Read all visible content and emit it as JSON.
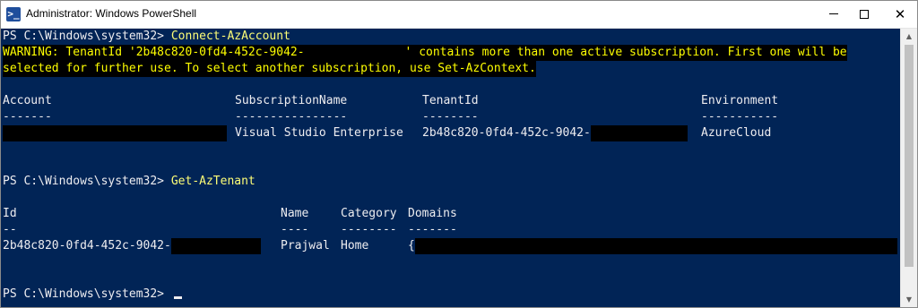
{
  "window": {
    "title": "Administrator: Windows PowerShell",
    "icon": "powershell-icon",
    "controls": {
      "minimize": "minimize-icon",
      "maximize": "maximize-icon",
      "close": "close-icon"
    }
  },
  "colors": {
    "console_background": "#012456",
    "console_text": "#eeedf0",
    "command_text": "#fefe77",
    "warning_text": "#fefe00",
    "warning_background": "#000000",
    "redaction": "#000000"
  },
  "console": {
    "prompt1": "PS C:\\Windows\\system32> ",
    "command1": "Connect-AzAccount",
    "warning_line1_part1": "WARNING: TenantId '2b48c820-0fd4-452c-9042-",
    "warning_line1_part2": "' contains more than one active subscription. First one will be",
    "warning_line2": "selected for further use. To select another subscription, use Set-AzContext.",
    "account_table": {
      "headers": [
        "Account",
        "SubscriptionName",
        "TenantId",
        "Environment"
      ],
      "underlines": [
        "-------",
        "----------------",
        "--------",
        "-----------"
      ],
      "row": {
        "subscription_name": "Visual Studio Enterprise",
        "tenant_id_prefix": "2b48c820-0fd4-452c-9042-",
        "environment": "AzureCloud"
      }
    },
    "prompt2": "PS C:\\Windows\\system32> ",
    "command2": "Get-AzTenant",
    "tenant_table": {
      "headers": [
        "Id",
        "Name",
        "Category",
        "Domains"
      ],
      "underlines": [
        "--",
        "----",
        "--------",
        "-------"
      ],
      "row": {
        "id_prefix": "2b48c820-0fd4-452c-9042-",
        "name": "Prajwal",
        "category": "Home",
        "domains_prefix": "{"
      }
    },
    "prompt3": "PS C:\\Windows\\system32> "
  }
}
